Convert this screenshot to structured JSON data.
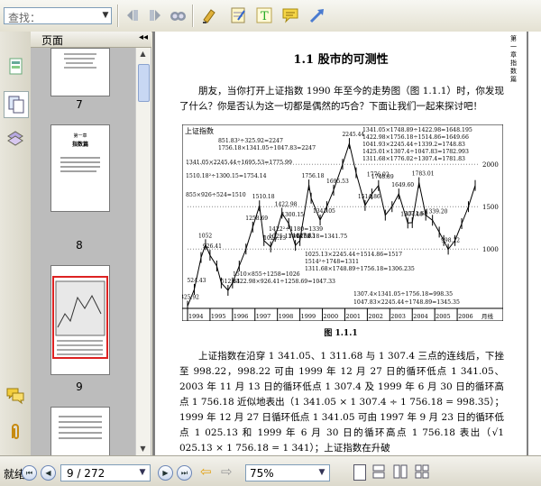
{
  "toolbar": {
    "search_value": "查找：",
    "buttons": [
      "prev-find",
      "next-find",
      "find-options",
      "highlight",
      "note-pad",
      "text",
      "comment",
      "arrow"
    ]
  },
  "sidebar": {
    "panel_title": "页面",
    "collapse_symbol": "◂◂",
    "thumbnails": [
      {
        "label": "7"
      },
      {
        "label": "8",
        "chapter": "第一章",
        "heading": "指数篇"
      },
      {
        "label": "9"
      }
    ]
  },
  "page": {
    "side_header": "第一章 指数篇",
    "title": "1.1   股市的可测性",
    "para1": "朋友，当你打开上证指数 1990 年至今的走势图（图 1.1.1）时，你发现了什么？你是否认为这一切都是偶然的巧合？下面让我们一起来探讨吧！",
    "figure_caption": "图 1.1.1",
    "para2": "上证指数在沿穿 1 341.05、1 311.68 与 1 307.4 三点的连线后，下挫至 998.22，998.22 可由 1999 年 12 月 27 日的循环低点 1 341.05、2003 年 11 月 13 日的循环低点 1 307.4 及 1999 年 6 月 30 日的循环高点 1 756.18 近似地表出（1 341.05 × 1 307.4 ÷ 1 756.18 = 998.35）；1999 年 12 月 27 日循环低点 1 341.05 可由 1997 年 9 月 23 日的循环低点 1 025.13 和 1999 年 6 月 30 日的循环高点 1 756.18 表出（√1 025.13 × 1 756.18 = 1 341）；上证指数在升破"
  },
  "chart_data": {
    "type": "line",
    "title": "上证指数",
    "x_ticks": [
      "1994",
      "1995",
      "1996",
      "1997",
      "1998",
      "1999",
      "2000",
      "2001",
      "2002",
      "2003",
      "2004",
      "2005",
      "2006"
    ],
    "x_unit": "月线",
    "y_ticks": [
      1000,
      1500,
      2000
    ],
    "annotations": [
      "1341.05×1748.89÷1422.98=1648.195",
      "1422.98×1756.18÷1514.86=1649.66",
      "1041.93×2245.44÷1339.2=1748.83",
      "1425.01×1307.4÷1047.83=1782.993",
      "1311.68×1776.02÷1307.4=1781.83",
      "851.83²÷325.92=2247",
      "1756.18×1341.05÷1047.83=2247",
      "1341.05×2245.44÷1695.53=1775.99",
      "1510.18²÷1300.15=1754.14",
      "855×926÷524=1510",
      "1422²÷1180=1339",
      "1025.13×1756.18=1341.75",
      "1025.13×2245.44÷1514.86=1517",
      "1514²÷1748=1311",
      "1311.68×1748.89÷1756.18=1306.235",
      "1510×855÷1258=1026",
      "1422.98×926.41÷1258.69=1047.33",
      "1307.4×1341.05÷1756.18=998.35",
      "1047.83×2245.44÷1748.89=1345.35"
    ],
    "point_labels": [
      "325.92",
      "524.43",
      "512.83",
      "926.41",
      "1052",
      "1510.18",
      "1258.69",
      "1422.98",
      "1025.13",
      "1043.02",
      "1047.83",
      "1300.15",
      "1756.18",
      "1341.05",
      "1695.53",
      "2245.44",
      "1514.86",
      "1776.02",
      "1748.89",
      "1649.60",
      "1339.20",
      "1307.40",
      "1311.68",
      "1783.01",
      "998.22"
    ],
    "series": [
      {
        "x": [
          1994.0,
          1994.3,
          1994.6,
          1994.8,
          1995.0,
          1995.3,
          1995.5,
          1995.8,
          1996.0,
          1996.3,
          1996.6,
          1996.9,
          1997.2,
          1997.4,
          1997.7,
          1997.9,
          1998.2,
          1998.5,
          1998.8,
          1999.0,
          1999.4,
          1999.5,
          1999.9,
          2000.2,
          2000.5,
          2000.9,
          2001.2,
          2001.5,
          2001.9,
          2002.2,
          2002.5,
          2002.8,
          2003.1,
          2003.4,
          2003.8,
          2004.0,
          2004.3,
          2004.6,
          2004.9,
          2005.2,
          2005.4,
          2005.6,
          2005.9,
          2006.2,
          2006.5,
          2006.8
        ],
        "y": [
          325.92,
          524.43,
          900,
          1052,
          926.41,
          800,
          600,
          512.83,
          600,
          800,
          1000,
          1258.69,
          1510.18,
          1100,
          1025.13,
          1150,
          1422.98,
          1300,
          1043.02,
          1100,
          1756.18,
          1600,
          1341.05,
          1500,
          1695.53,
          2000,
          2245.44,
          1900,
          1514.86,
          1650,
          1748.89,
          1400,
          1500,
          1649.6,
          1307.4,
          1311.68,
          1783.01,
          1400,
          1339.2,
          1200,
          1100,
          998.22,
          1100,
          1300,
          1500,
          1750
        ]
      }
    ],
    "ylim": [
      300,
      2300
    ],
    "xlim": [
      1994,
      2007
    ]
  },
  "statusbar": {
    "left_label": "就绪",
    "page_value": "9 / 272",
    "zoom_value": "75%"
  }
}
